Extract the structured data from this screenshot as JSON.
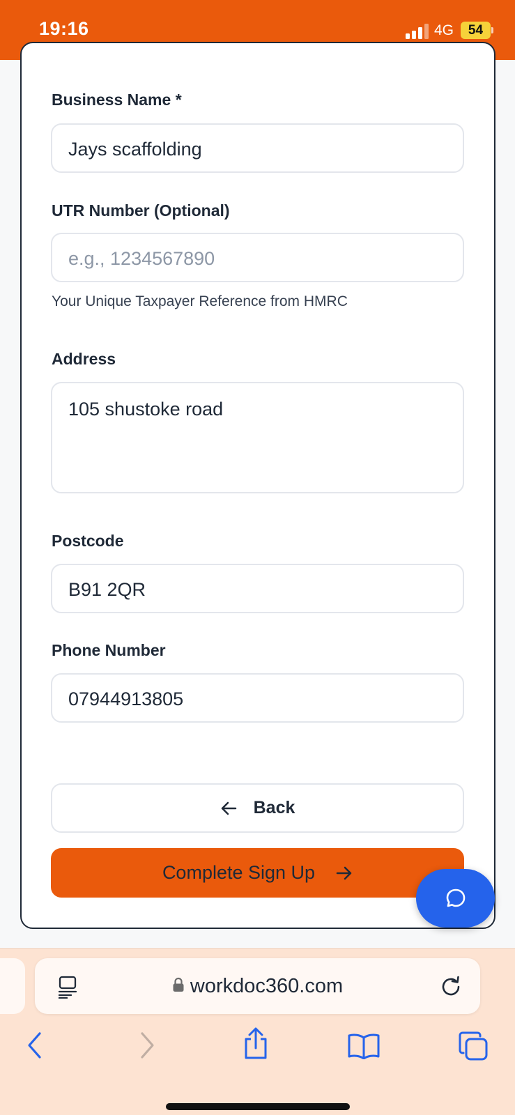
{
  "status_bar": {
    "time": "19:16",
    "network": "4G",
    "battery": "54"
  },
  "form": {
    "business_name": {
      "label": "Business Name *",
      "value": "Jays scaffolding"
    },
    "utr_number": {
      "label": "UTR Number (Optional)",
      "placeholder": "e.g., 1234567890",
      "hint": "Your Unique Taxpayer Reference from HMRC"
    },
    "address": {
      "label": "Address",
      "value": "105 shustoke road"
    },
    "postcode": {
      "label": "Postcode",
      "value": "B91 2QR"
    },
    "phone": {
      "label": "Phone Number",
      "value": "07944913805"
    },
    "back_label": "Back",
    "submit_label": "Complete Sign Up"
  },
  "browser": {
    "url": "workdoc360.com"
  },
  "colors": {
    "brand": "#ea5a0c",
    "chat": "#2563eb",
    "browser_bg": "#fde3d2"
  }
}
